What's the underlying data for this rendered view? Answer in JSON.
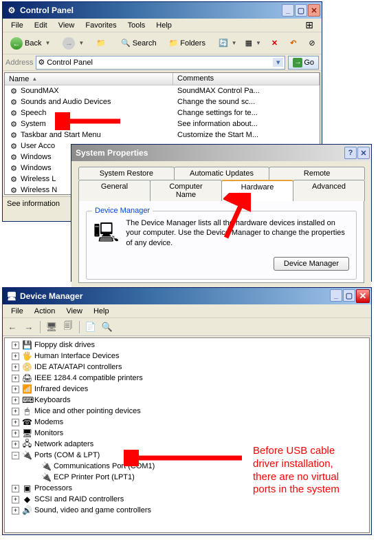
{
  "control_panel": {
    "title": "Control Panel",
    "menu": [
      "File",
      "Edit",
      "View",
      "Favorites",
      "Tools",
      "Help"
    ],
    "back_label": "Back",
    "search_label": "Search",
    "folders_label": "Folders",
    "address_label": "Address",
    "address_value": "Control Panel",
    "go_label": "Go",
    "col_name": "Name",
    "col_comments": "Comments",
    "name_tri": "▲",
    "items": [
      {
        "name": "SoundMAX",
        "comment": "SoundMAX Control Pa..."
      },
      {
        "name": "Sounds and Audio Devices",
        "comment": "Change the sound sc..."
      },
      {
        "name": "Speech",
        "comment": "Change settings for te..."
      },
      {
        "name": "System",
        "comment": "See information about..."
      },
      {
        "name": "Taskbar and Start Menu",
        "comment": "Customize the Start M..."
      },
      {
        "name": "User Acco",
        "comment": ""
      },
      {
        "name": "Windows",
        "comment": ""
      },
      {
        "name": "Windows",
        "comment": ""
      },
      {
        "name": "Wireless L",
        "comment": ""
      },
      {
        "name": "Wireless N",
        "comment": ""
      }
    ],
    "status_text": "See information"
  },
  "system_properties": {
    "title": "System Properties",
    "tabs_top": [
      "System Restore",
      "Automatic Updates",
      "Remote"
    ],
    "tabs_bot": [
      "General",
      "Computer Name",
      "Hardware",
      "Advanced"
    ],
    "active_tab": "Hardware",
    "group_title": "Device Manager",
    "group_text": "The Device Manager lists all the hardware devices installed on your computer. Use the Device Manager to change the properties of any device.",
    "button_label": "Device Manager"
  },
  "device_manager": {
    "title": "Device Manager",
    "menu": [
      "File",
      "Action",
      "View",
      "Help"
    ],
    "tree": [
      {
        "depth": 1,
        "pm": "+",
        "icon": "💾",
        "label": "Floppy disk drives"
      },
      {
        "depth": 1,
        "pm": "+",
        "icon": "🖐",
        "label": "Human Interface Devices"
      },
      {
        "depth": 1,
        "pm": "+",
        "icon": "📀",
        "label": "IDE ATA/ATAPI controllers"
      },
      {
        "depth": 1,
        "pm": "+",
        "icon": "🖨",
        "label": "IEEE 1284.4 compatible printers"
      },
      {
        "depth": 1,
        "pm": "+",
        "icon": "📶",
        "label": "Infrared devices"
      },
      {
        "depth": 1,
        "pm": "+",
        "icon": "⌨",
        "label": "Keyboards"
      },
      {
        "depth": 1,
        "pm": "+",
        "icon": "🖱",
        "label": "Mice and other pointing devices"
      },
      {
        "depth": 1,
        "pm": "+",
        "icon": "☎",
        "label": "Modems"
      },
      {
        "depth": 1,
        "pm": "+",
        "icon": "🖥",
        "label": "Monitors"
      },
      {
        "depth": 1,
        "pm": "+",
        "icon": "🖧",
        "label": "Network adapters"
      },
      {
        "depth": 1,
        "pm": "−",
        "icon": "🔌",
        "label": "Ports (COM & LPT)"
      },
      {
        "depth": 2,
        "pm": "",
        "icon": "🔌",
        "label": "Communications Port (COM1)"
      },
      {
        "depth": 2,
        "pm": "",
        "icon": "🔌",
        "label": "ECP Printer Port (LPT1)"
      },
      {
        "depth": 1,
        "pm": "+",
        "icon": "▣",
        "label": "Processors"
      },
      {
        "depth": 1,
        "pm": "+",
        "icon": "◆",
        "label": "SCSI and RAID controllers"
      },
      {
        "depth": 1,
        "pm": "+",
        "icon": "🔊",
        "label": "Sound, video and game controllers"
      }
    ]
  },
  "annotation": "Before USB cable\ndriver installation,\nthere are no virtual\nports in the system"
}
